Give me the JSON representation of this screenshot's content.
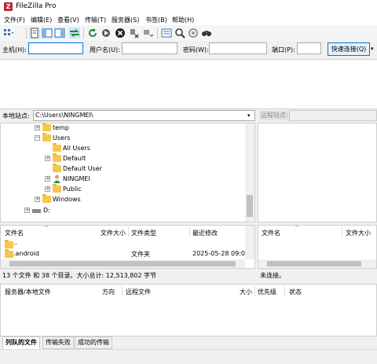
{
  "window": {
    "title": "FileZilla Pro",
    "app_icon_letter": "Z"
  },
  "menu": [
    "文件(F)",
    "编辑(E)",
    "查看(V)",
    "传输(T)",
    "服务器(S)",
    "书签(B)",
    "帮助(H)"
  ],
  "toolbar": {
    "icons": [
      "site-manager-icon",
      "toggle-message-log-icon",
      "toggle-local-tree-icon",
      "toggle-remote-tree-icon",
      "toggle-queue-icon",
      "refresh-icon",
      "process-queue-icon",
      "cancel-icon",
      "disconnect-icon",
      "reconnect-icon",
      "directory-filter-icon",
      "search-icon",
      "compare-icon",
      "find-files-icon"
    ]
  },
  "quickconnect": {
    "host_label": "主机(H):",
    "host_value": "",
    "user_label": "用户名(U):",
    "user_value": "",
    "pass_label": "密码(W):",
    "pass_value": "",
    "port_label": "端口(P):",
    "port_value": "",
    "button_label": "快速连接(Q)"
  },
  "local_site": {
    "label": "本地站点:",
    "path": "C:\\Users\\NINGMEI\\"
  },
  "remote_site": {
    "label": "远程站点:",
    "path": ""
  },
  "local_tree": [
    {
      "label": "temp",
      "expander": "+",
      "icon": "folder"
    },
    {
      "label": "Users",
      "expander": "−",
      "icon": "folder"
    },
    {
      "label": "All Users",
      "expander": "",
      "icon": "folder"
    },
    {
      "label": "Default",
      "expander": "+",
      "icon": "folder"
    },
    {
      "label": "Default User",
      "expander": "",
      "icon": "folder"
    },
    {
      "label": "NINGMEI",
      "expander": "+",
      "icon": "user"
    },
    {
      "label": "Public",
      "expander": "+",
      "icon": "folder"
    },
    {
      "label": "Windows",
      "expander": "+",
      "icon": "folder"
    },
    {
      "label": "D:",
      "expander": "+",
      "icon": "drive"
    }
  ],
  "local_files": {
    "columns": [
      "文件名",
      "文件大小",
      "文件类型",
      "最近修改"
    ],
    "rows": [
      {
        "name": "..",
        "size": "",
        "type": "",
        "modified": ""
      },
      {
        "name": ".android",
        "size": "",
        "type": "文件夹",
        "modified": "2025-05-28 09:0..."
      }
    ],
    "status": "13 个文件 和 38 个目录。大小总计: 12,513,802 字节"
  },
  "remote_files": {
    "columns": [
      "文件名",
      "文件大小"
    ],
    "status": "未连接。"
  },
  "queue": {
    "columns": [
      "服务器/本地文件",
      "方向",
      "远程文件",
      "大小",
      "优先级",
      "状态"
    ],
    "tabs": [
      "列队的文件",
      "传输失败",
      "成功的传输"
    ]
  }
}
